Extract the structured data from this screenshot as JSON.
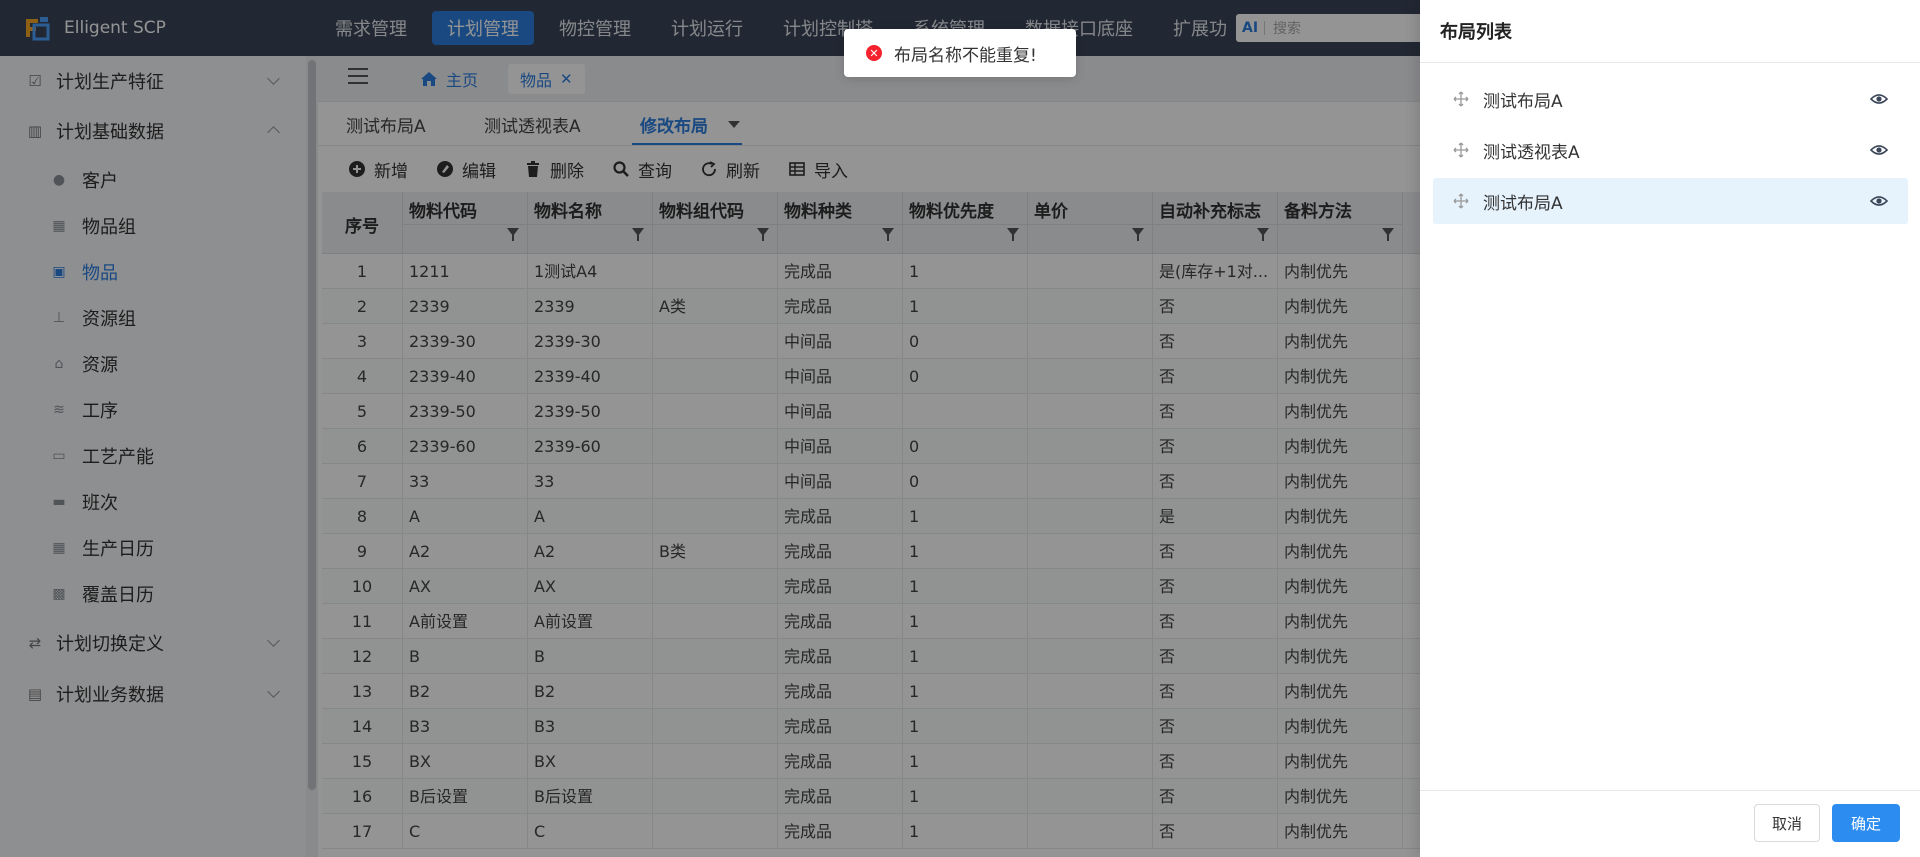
{
  "app": {
    "name": "Elligent SCP"
  },
  "topnav": {
    "items": [
      "需求管理",
      "计划管理",
      "物控管理",
      "计划运行",
      "计划控制塔",
      "系统管理",
      "数据接口底座",
      "扩展功"
    ],
    "active_index": 1,
    "search": {
      "ai_label": "AI",
      "placeholder": "搜索"
    }
  },
  "sidebar": {
    "groups": [
      {
        "label": "计划生产特征",
        "icon": "clipboard-check-icon",
        "expanded": false
      },
      {
        "label": "计划基础数据",
        "icon": "building-icon",
        "expanded": true
      },
      {
        "label": "计划切换定义",
        "icon": "switch-arrows-icon",
        "expanded": false
      },
      {
        "label": "计划业务数据",
        "icon": "clipboard-icon",
        "expanded": false
      }
    ],
    "items": [
      {
        "label": "客户",
        "icon": "users-icon"
      },
      {
        "label": "物品组",
        "icon": "grid-icon"
      },
      {
        "label": "物品",
        "icon": "box-icon",
        "active": true
      },
      {
        "label": "资源组",
        "icon": "hierarchy-icon"
      },
      {
        "label": "资源",
        "icon": "cart-icon"
      },
      {
        "label": "工序",
        "icon": "process-icon"
      },
      {
        "label": "工艺产能",
        "icon": "capacity-icon"
      },
      {
        "label": "班次",
        "icon": "shift-icon"
      },
      {
        "label": "生产日历",
        "icon": "calendar-icon"
      },
      {
        "label": "覆盖日历",
        "icon": "calendar-overlay-icon"
      }
    ]
  },
  "tabs": {
    "home": "主页",
    "current": "物品"
  },
  "layout_tabs": {
    "items": [
      "测试布局A",
      "测试透视表A",
      "修改布局"
    ],
    "active_index": 2
  },
  "toolbar": {
    "add": "新增",
    "edit": "编辑",
    "delete": "删除",
    "query": "查询",
    "refresh": "刷新",
    "import": "导入"
  },
  "table": {
    "columns": [
      "序号",
      "物料代码",
      "物料名称",
      "物料组代码",
      "物料种类",
      "物料优先度",
      "单价",
      "自动补充标志",
      "备料方法"
    ],
    "rows": [
      [
        "1",
        "1211",
        "1测试A4",
        "",
        "完成品",
        "1",
        "",
        "是(库存+1对...",
        "内制优先"
      ],
      [
        "2",
        "2339",
        "2339",
        "A类",
        "完成品",
        "1",
        "",
        "否",
        "内制优先"
      ],
      [
        "3",
        "2339-30",
        "2339-30",
        "",
        "中间品",
        "0",
        "",
        "否",
        "内制优先"
      ],
      [
        "4",
        "2339-40",
        "2339-40",
        "",
        "中间品",
        "0",
        "",
        "否",
        "内制优先"
      ],
      [
        "5",
        "2339-50",
        "2339-50",
        "",
        "中间品",
        "",
        "",
        "否",
        "内制优先"
      ],
      [
        "6",
        "2339-60",
        "2339-60",
        "",
        "中间品",
        "0",
        "",
        "否",
        "内制优先"
      ],
      [
        "7",
        "33",
        "33",
        "",
        "中间品",
        "0",
        "",
        "否",
        "内制优先"
      ],
      [
        "8",
        "A",
        "A",
        "",
        "完成品",
        "1",
        "",
        "是",
        "内制优先"
      ],
      [
        "9",
        "A2",
        "A2",
        "B类",
        "完成品",
        "1",
        "",
        "否",
        "内制优先"
      ],
      [
        "10",
        "AX",
        "AX",
        "",
        "完成品",
        "1",
        "",
        "否",
        "内制优先"
      ],
      [
        "11",
        "A前设置",
        "A前设置",
        "",
        "完成品",
        "1",
        "",
        "否",
        "内制优先"
      ],
      [
        "12",
        "B",
        "B",
        "",
        "完成品",
        "1",
        "",
        "否",
        "内制优先"
      ],
      [
        "13",
        "B2",
        "B2",
        "",
        "完成品",
        "1",
        "",
        "否",
        "内制优先"
      ],
      [
        "14",
        "B3",
        "B3",
        "",
        "完成品",
        "1",
        "",
        "否",
        "内制优先"
      ],
      [
        "15",
        "BX",
        "BX",
        "",
        "完成品",
        "1",
        "",
        "否",
        "内制优先"
      ],
      [
        "16",
        "B后设置",
        "B后设置",
        "",
        "完成品",
        "1",
        "",
        "否",
        "内制优先"
      ],
      [
        "17",
        "C",
        "C",
        "",
        "完成品",
        "1",
        "",
        "否",
        "内制优先"
      ]
    ]
  },
  "toast": {
    "type": "error",
    "message": "布局名称不能重复!"
  },
  "drawer": {
    "title": "布局列表",
    "items": [
      {
        "label": "测试布局A",
        "selected": false
      },
      {
        "label": "测试透视表A",
        "selected": false
      },
      {
        "label": "测试布局A",
        "selected": true
      }
    ],
    "cancel": "取消",
    "confirm": "确定"
  },
  "colors": {
    "accent": "#2d7fe0",
    "topbar": "#3b4658",
    "selected_row": "#e6f3fd",
    "error": "#f5222d"
  }
}
